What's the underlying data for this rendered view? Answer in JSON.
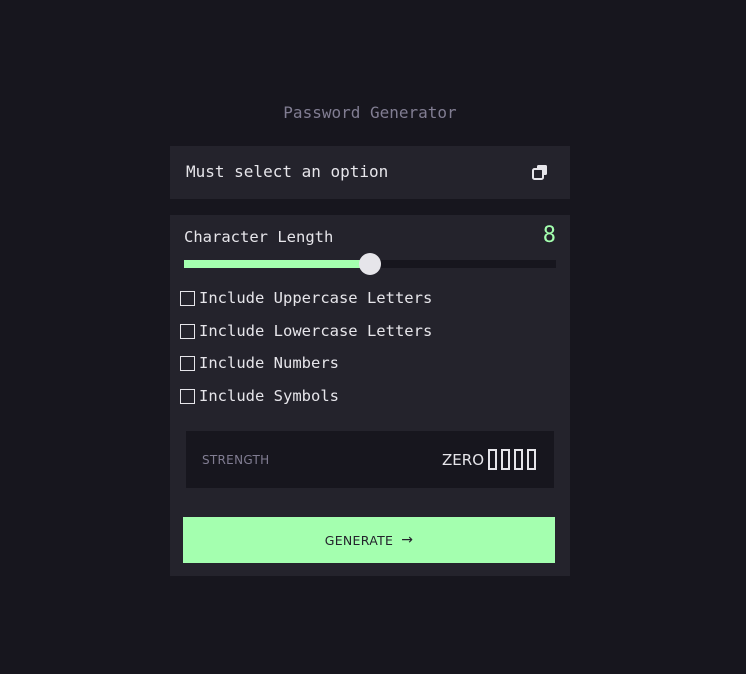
{
  "app": {
    "title": "Password Generator"
  },
  "output": {
    "text": "Must select an option",
    "copy_icon": "copy-icon"
  },
  "settings": {
    "length_label": "Character Length",
    "length_value": "8",
    "length_fraction": 0.5,
    "options": [
      {
        "label": "Include Uppercase Letters",
        "checked": false
      },
      {
        "label": "Include Lowercase Letters",
        "checked": false
      },
      {
        "label": "Include Numbers",
        "checked": false
      },
      {
        "label": "Include Symbols",
        "checked": false
      }
    ]
  },
  "strength": {
    "label": "STRENGTH",
    "value": "ZERO",
    "bars_filled": 0,
    "bars_total": 4
  },
  "generate": {
    "label": "GENERATE",
    "arrow": "→"
  },
  "colors": {
    "background": "#17161e",
    "panel": "#24232c",
    "accent": "#a4ffaf",
    "text": "#e6e5ea",
    "muted": "#817d92"
  }
}
